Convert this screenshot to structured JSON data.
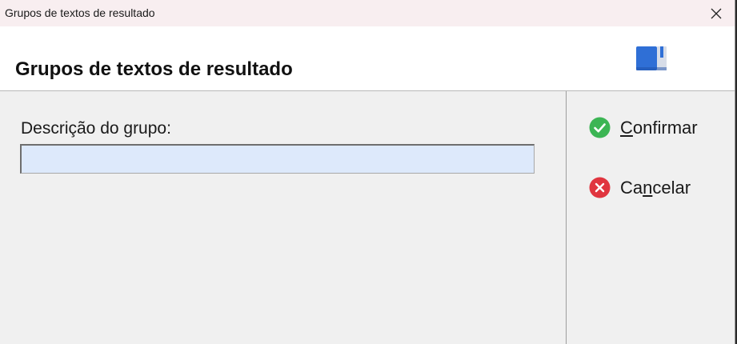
{
  "window": {
    "title": "Grupos de textos de resultado"
  },
  "header": {
    "title": "Grupos de textos de resultado",
    "icon": "book-icon"
  },
  "form": {
    "group_description_label": "Descrição do grupo:",
    "group_description_value": ""
  },
  "actions": {
    "confirm": {
      "pre": "",
      "access_key": "C",
      "post": "onfirmar",
      "icon": "check-circle-icon",
      "color": "#3cb554"
    },
    "cancel": {
      "pre": "Ca",
      "access_key": "n",
      "post": "celar",
      "icon": "x-circle-icon",
      "color": "#e0353f"
    }
  }
}
